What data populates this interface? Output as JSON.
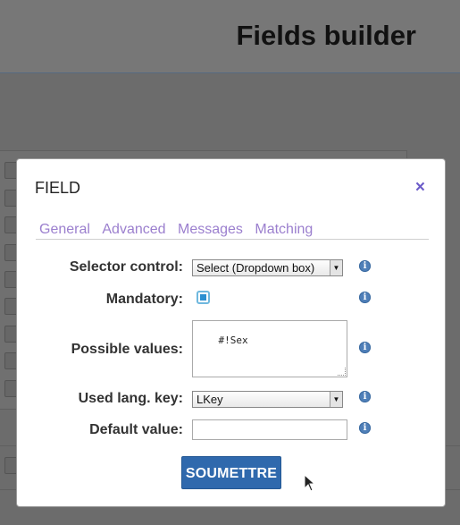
{
  "page": {
    "title": "Fields builder"
  },
  "dialog": {
    "title": "FIELD",
    "close_icon": "×",
    "tabs": [
      {
        "label": "General"
      },
      {
        "label": "Advanced"
      },
      {
        "label": "Messages"
      },
      {
        "label": "Matching"
      }
    ],
    "form": {
      "selector_control": {
        "label": "Selector control:",
        "value": "Select (Dropdown box)"
      },
      "mandatory": {
        "label": "Mandatory:",
        "checked": true
      },
      "possible_values": {
        "label": "Possible values:",
        "value": "#!Sex"
      },
      "used_lang_key": {
        "label": "Used lang. key:",
        "value": "LKey"
      },
      "default_value": {
        "label": "Default value:",
        "value": ""
      }
    },
    "info_icon": "i",
    "submit_label": "SOUMETTRE"
  },
  "colors": {
    "accent": "#2f69ad",
    "tab_link": "#9b7fce",
    "close": "#6b5bc9",
    "overlay": "#6f6f6f"
  }
}
